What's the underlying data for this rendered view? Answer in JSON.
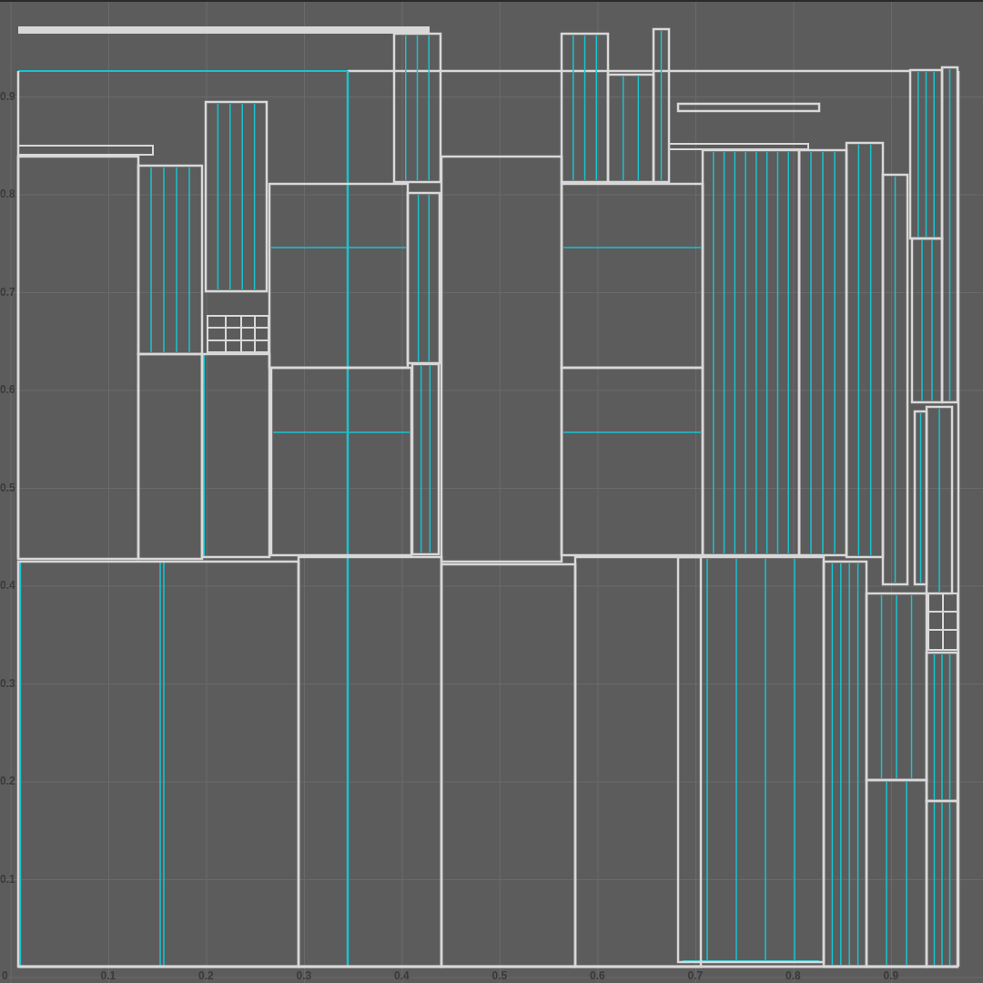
{
  "uv_editor": {
    "u_axis_labels": [
      "0",
      "0.1",
      "0.2",
      "0.3",
      "0.4",
      "0.5",
      "0.6",
      "0.7",
      "0.8",
      "0.9"
    ],
    "v_axis_labels": [
      "0.9",
      "0.8",
      "0.7",
      "0.6",
      "0.5",
      "0.4",
      "0.3",
      "0.2",
      "0.1"
    ]
  }
}
